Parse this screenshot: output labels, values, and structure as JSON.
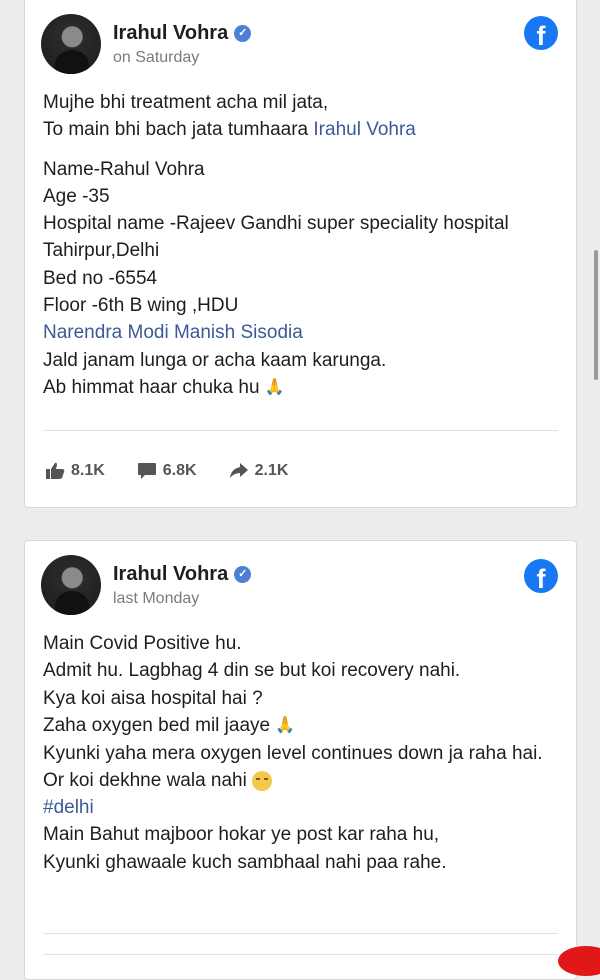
{
  "colors": {
    "facebook_blue": "#1877f2",
    "link": "#3b5998",
    "verified": "#4d7fd6"
  },
  "posts": [
    {
      "author": "Irahul Vohra",
      "time": "on Saturday",
      "lines": [
        {
          "text": "Mujhe bhi treatment acha mil jata,"
        },
        {
          "prefix": "To main bhi bach jata tumhaara ",
          "link": "Irahul Vohra"
        },
        {
          "text": "Name-Rahul Vohra"
        },
        {
          "text": "Age -35"
        },
        {
          "text": "Hospital name -Rajeev Gandhi super speciality hospital"
        },
        {
          "text": "Tahirpur,Delhi"
        },
        {
          "text": "Bed no -6554"
        },
        {
          "text": "Floor -6th B wing ,HDU"
        },
        {
          "link": "Narendra Modi Manish Sisodia"
        },
        {
          "text": "Jald janam lunga or acha kaam karunga."
        },
        {
          "text": "Ab himmat haar chuka hu",
          "emoji": "folded-hands"
        }
      ],
      "stats": {
        "likes": "8.1K",
        "comments": "6.8K",
        "shares": "2.1K"
      }
    },
    {
      "author": "Irahul Vohra",
      "time": "last Monday",
      "lines": [
        {
          "text": "Main Covid Positive hu."
        },
        {
          "text": "Admit hu. Lagbhag 4 din se but koi recovery nahi."
        },
        {
          "text": "Kya koi aisa hospital hai ?"
        },
        {
          "text": "Zaha oxygen bed mil jaaye",
          "emoji": "folded-hands"
        },
        {
          "text": "Kyunki yaha mera oxygen level continues down ja raha hai."
        },
        {
          "text": "Or koi dekhne wala nahi",
          "emoji": "pensive-face"
        },
        {
          "link": "#delhi"
        },
        {
          "text": "Main Bahut majboor hokar ye post kar raha hu,"
        },
        {
          "text": "Kyunki ghawaale kuch sambhaal nahi paa rahe."
        }
      ]
    }
  ]
}
